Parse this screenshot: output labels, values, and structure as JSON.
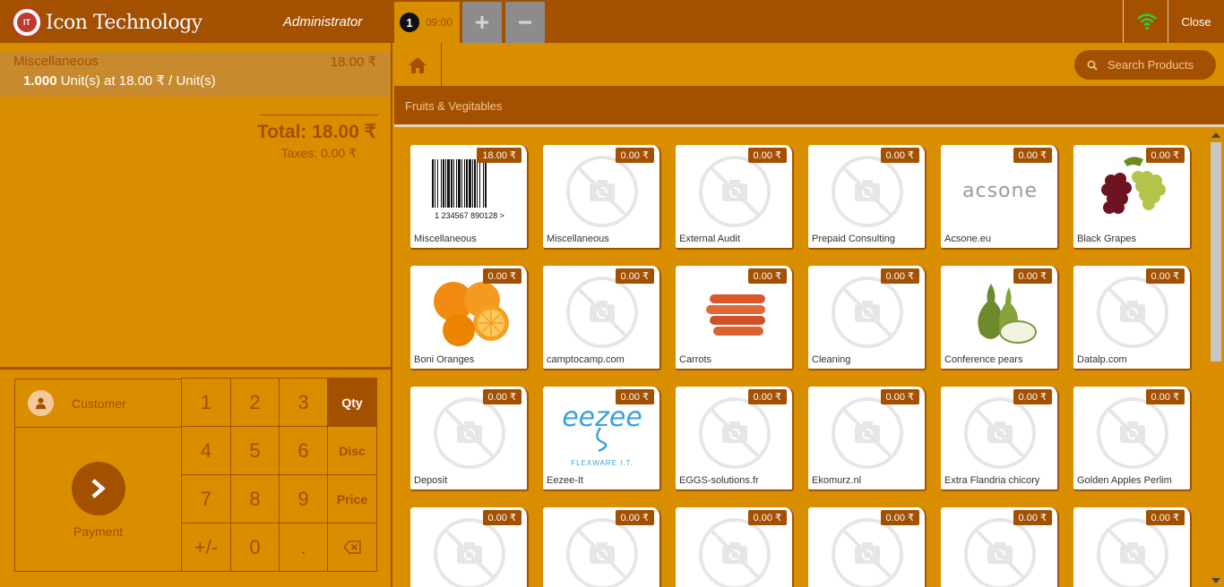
{
  "header": {
    "logo_text": "Icon Technology",
    "logo_badge": "IT",
    "cashier": "Administrator",
    "order": {
      "number": "1",
      "time": "09:00"
    },
    "close_label": "Close"
  },
  "orderline": {
    "name": "Miscellaneous",
    "price": "18.00 ₹",
    "qty": "1.000",
    "unit_info": "Unit(s) at 18.00 ₹ / Unit(s)"
  },
  "totals": {
    "total": "Total: 18.00 ₹",
    "taxes": "Taxes: 0.00 ₹"
  },
  "actionpad": {
    "customer_label": "Customer",
    "payment_label": "Payment"
  },
  "numpad": {
    "keys": [
      "1",
      "2",
      "3",
      "Qty",
      "4",
      "5",
      "6",
      "Disc",
      "7",
      "8",
      "9",
      "Price",
      "+/-",
      "0",
      "."
    ],
    "active_mode": "Qty"
  },
  "search": {
    "placeholder": "Search Products"
  },
  "category": {
    "current": "Fruits & Vegitables"
  },
  "products": [
    {
      "name": "Miscellaneous",
      "price": "18.00 ₹",
      "image": "barcode",
      "barcode_text": "1 234567 890128 >"
    },
    {
      "name": "Miscellaneous",
      "price": "0.00 ₹",
      "image": "no-image"
    },
    {
      "name": "External Audit",
      "price": "0.00 ₹",
      "image": "no-image"
    },
    {
      "name": "Prepaid Consulting",
      "price": "0.00 ₹",
      "image": "no-image"
    },
    {
      "name": "Acsone.eu",
      "price": "0.00 ₹",
      "image": "acsone-logo",
      "logo_text": "acsone"
    },
    {
      "name": "Black Grapes",
      "price": "0.00 ₹",
      "image": "grapes"
    },
    {
      "name": "Boni Oranges",
      "price": "0.00 ₹",
      "image": "oranges"
    },
    {
      "name": "camptocamp.com",
      "price": "0.00 ₹",
      "image": "no-image"
    },
    {
      "name": "Carrots",
      "price": "0.00 ₹",
      "image": "carrots"
    },
    {
      "name": "Cleaning",
      "price": "0.00 ₹",
      "image": "no-image"
    },
    {
      "name": "Conference pears",
      "price": "0.00 ₹",
      "image": "pears"
    },
    {
      "name": "Datalp.com",
      "price": "0.00 ₹",
      "image": "no-image"
    },
    {
      "name": "Deposit",
      "price": "0.00 ₹",
      "image": "no-image"
    },
    {
      "name": "Eezee-It",
      "price": "0.00 ₹",
      "image": "eezee-logo",
      "logo_text": "eezee",
      "logo_subtext": "FLEXWARE I.T."
    },
    {
      "name": "EGGS-solutions.fr",
      "price": "0.00 ₹",
      "image": "no-image"
    },
    {
      "name": "Ekomurz.nl",
      "price": "0.00 ₹",
      "image": "no-image"
    },
    {
      "name": "Extra Flandria chicory",
      "price": "0.00 ₹",
      "image": "no-image"
    },
    {
      "name": "Golden Apples Perlim",
      "price": "0.00 ₹",
      "image": "no-image"
    },
    {
      "name": "",
      "price": "0.00 ₹",
      "image": "no-image"
    },
    {
      "name": "",
      "price": "0.00 ₹",
      "image": "no-image"
    },
    {
      "name": "",
      "price": "0.00 ₹",
      "image": "no-image"
    },
    {
      "name": "",
      "price": "0.00 ₹",
      "image": "no-image"
    },
    {
      "name": "",
      "price": "0.00 ₹",
      "image": "no-image"
    },
    {
      "name": "",
      "price": "0.00 ₹",
      "image": "no-image"
    }
  ],
  "colors": {
    "brand_dark": "#a35000",
    "brand_light": "#d98e00",
    "selected_line": "#c88a2e",
    "wifi": "#2ecc40"
  }
}
